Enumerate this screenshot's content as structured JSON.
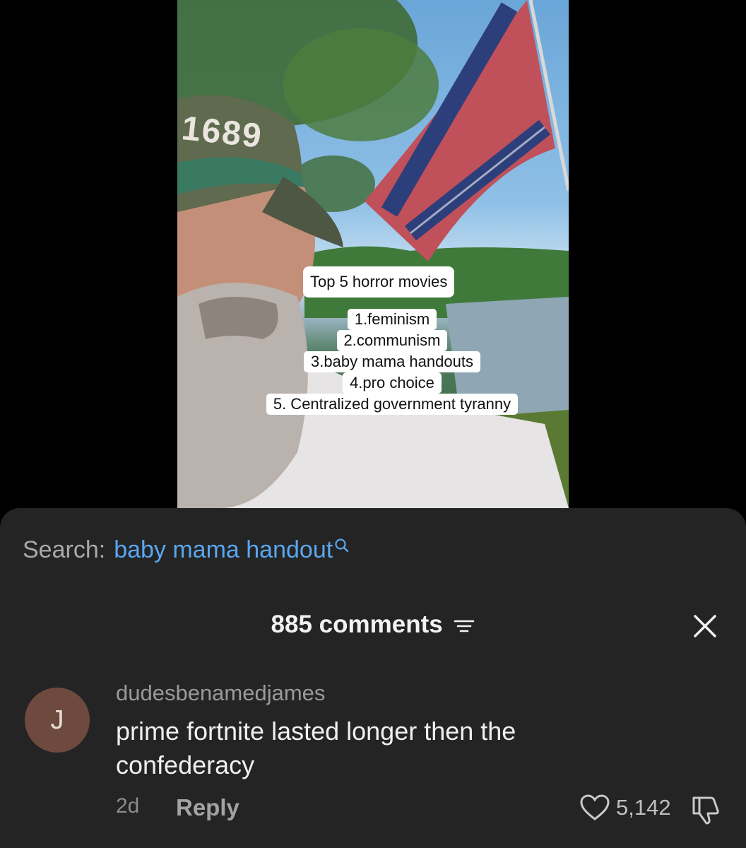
{
  "video": {
    "hat_text": "1689",
    "overlay_title": "Top 5 horror movies",
    "overlay_list": [
      "1.feminism",
      "2.communism",
      "3.baby mama handouts",
      "4.pro choice",
      "5. Centralized government tyranny"
    ]
  },
  "search": {
    "label": "Search:",
    "term": "baby mama handout",
    "icon": "search-icon"
  },
  "comments": {
    "header": "885 comments",
    "filter_icon": "filter-icon",
    "close_icon": "close-icon",
    "items": [
      {
        "avatar_letter": "J",
        "username": "dudesbenamedjames",
        "text": "prime fortnite lasted longer then the confederacy",
        "time": "2d",
        "reply_label": "Reply",
        "likes": "5,142",
        "like_icon": "heart-icon",
        "dislike_icon": "thumbs-down-icon"
      }
    ]
  },
  "colors": {
    "sheet_bg": "#242424",
    "search_term": "#5aa6ef",
    "avatar_bg": "#6e4a3e"
  }
}
